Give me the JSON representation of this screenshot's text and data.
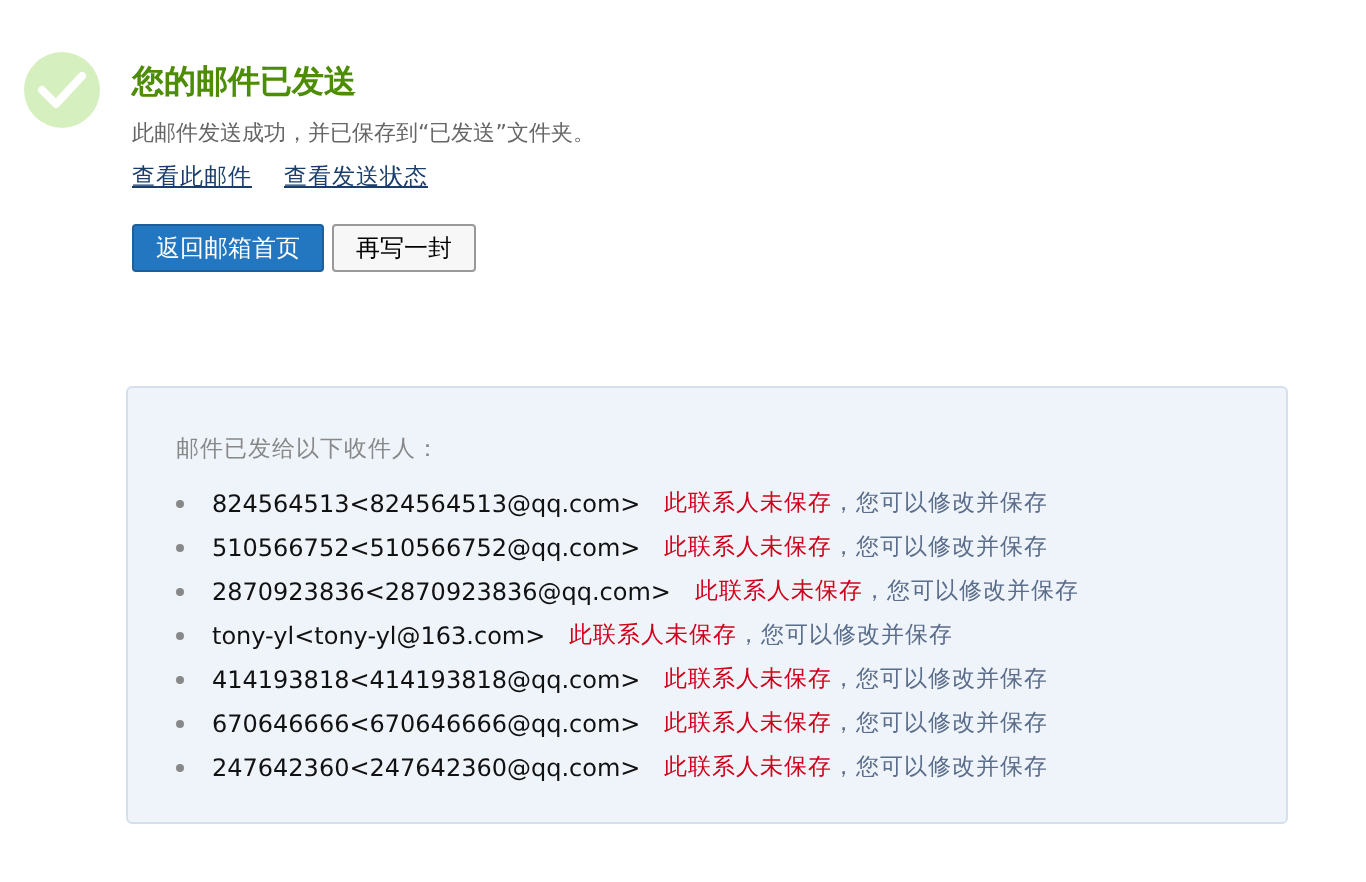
{
  "status": {
    "title": "您的邮件已发送",
    "message": "此邮件发送成功，并已保存到“已发送”文件夹。"
  },
  "links": [
    "查看此邮件",
    "查看发送状态"
  ],
  "buttons": [
    {
      "label": "返回邮箱首页",
      "kind": "primary"
    },
    {
      "label": "再写一封",
      "kind": "secondary"
    }
  ],
  "recipients": {
    "heading": "邮件已发给以下收件人：",
    "items": [
      {
        "address": "824564513<824564513@qq.com>",
        "warning": "此联系人未保存",
        "hint": "，您可以修改并保存"
      },
      {
        "address": "510566752<510566752@qq.com>",
        "warning": "此联系人未保存",
        "hint": "，您可以修改并保存"
      },
      {
        "address": "2870923836<2870923836@qq.com>",
        "warning": "此联系人未保存",
        "hint": "，您可以修改并保存"
      },
      {
        "address": "tony-yl<tony-yl@163.com>",
        "warning": "此联系人未保存",
        "hint": "，您可以修改并保存"
      },
      {
        "address": "414193818<414193818@qq.com>",
        "warning": "此联系人未保存",
        "hint": "，您可以修改并保存"
      },
      {
        "address": "670646666<670646666@qq.com>",
        "warning": "此联系人未保存",
        "hint": "，您可以修改并保存"
      },
      {
        "address": "247642360<247642360@qq.com>",
        "warning": "此联系人未保存",
        "hint": "，您可以修改并保存"
      }
    ]
  }
}
